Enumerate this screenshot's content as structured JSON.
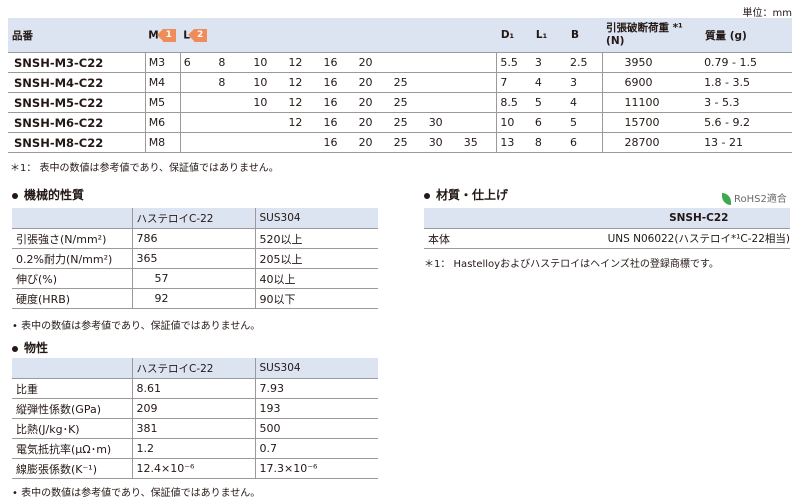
{
  "unit": "単位：mm",
  "main_table": {
    "headers": {
      "part": "品番",
      "m": "M",
      "m_badge": "1",
      "l": "L",
      "l_badge": "2",
      "d1": "D₁",
      "l1": "L₁",
      "b": "B",
      "load_line1": "引張破断荷重 *¹",
      "load_line2": "(N)",
      "mass": "質量 (g)"
    },
    "rows": [
      {
        "part": "SNSH-M3-C22",
        "m": "M3",
        "l": [
          "6",
          "8",
          "10",
          "12",
          "16",
          "20",
          "",
          "",
          ""
        ],
        "d1": "5.5",
        "l1": "3",
        "b": "2.5",
        "load": "3950",
        "mass": "0.79 -  1.5"
      },
      {
        "part": "SNSH-M4-C22",
        "m": "M4",
        "l": [
          "",
          "8",
          "10",
          "12",
          "16",
          "20",
          "25",
          "",
          ""
        ],
        "d1": "7",
        "l1": "4",
        "b": "3",
        "load": "6900",
        "mass": "1.8  -  3.5"
      },
      {
        "part": "SNSH-M5-C22",
        "m": "M5",
        "l": [
          "",
          "",
          "10",
          "12",
          "16",
          "20",
          "25",
          "",
          ""
        ],
        "d1": "8.5",
        "l1": "5",
        "b": "4",
        "load": "11100",
        "mass": "3    -  5.3"
      },
      {
        "part": "SNSH-M6-C22",
        "m": "M6",
        "l": [
          "",
          "",
          "",
          "12",
          "16",
          "20",
          "25",
          "30",
          ""
        ],
        "d1": "10",
        "l1": "6",
        "b": "5",
        "load": "15700",
        "mass": "5.6  -  9.2"
      },
      {
        "part": "SNSH-M8-C22",
        "m": "M8",
        "l": [
          "",
          "",
          "",
          "",
          "16",
          "20",
          "25",
          "30",
          "35"
        ],
        "d1": "13",
        "l1": "8",
        "b": "6",
        "load": "28700",
        "mass": "13   -  21"
      }
    ],
    "note": "＊1：  表中の数値は参考値であり、保証値ではありません。"
  },
  "mechanical": {
    "title": "機械的性質",
    "headers": [
      "",
      "ハステロイC-22",
      "SUS304"
    ],
    "rows": [
      [
        "引張強さ(N/mm²)",
        "786",
        "520以上"
      ],
      [
        "0.2%耐力(N/mm²)",
        "365",
        "205以上"
      ],
      [
        "伸び(%)",
        "57",
        "40以上"
      ],
      [
        "硬度(HRB)",
        "92",
        "90以下"
      ]
    ],
    "note": "• 表中の数値は参考値であり、保証値ではありません。"
  },
  "physical": {
    "title": "物性",
    "headers": [
      "",
      "ハステロイC-22",
      "SUS304"
    ],
    "rows": [
      [
        "比重",
        "8.61",
        "7.93"
      ],
      [
        "縦弾性係数(GPa)",
        "209",
        "193"
      ],
      [
        "比熱(J/kg･K)",
        "381",
        "500"
      ],
      [
        "電気抵抗率(μΩ･m)",
        "1.2",
        "0.7"
      ],
      [
        "線膨張係数(K⁻¹)",
        "12.4×10⁻⁶",
        "17.3×10⁻⁶"
      ]
    ],
    "note": "• 表中の数値は参考値であり、保証値ではありません。"
  },
  "material": {
    "title": "材質・仕上げ",
    "rohs": "RoHS2適合",
    "header": "SNSH-C22",
    "row": [
      "本体",
      "UNS N06022(ハステロイ*¹C-22相当)"
    ],
    "note": "＊1：  Hastelloyおよびハステロイはヘインズ社の登録商標です。"
  }
}
